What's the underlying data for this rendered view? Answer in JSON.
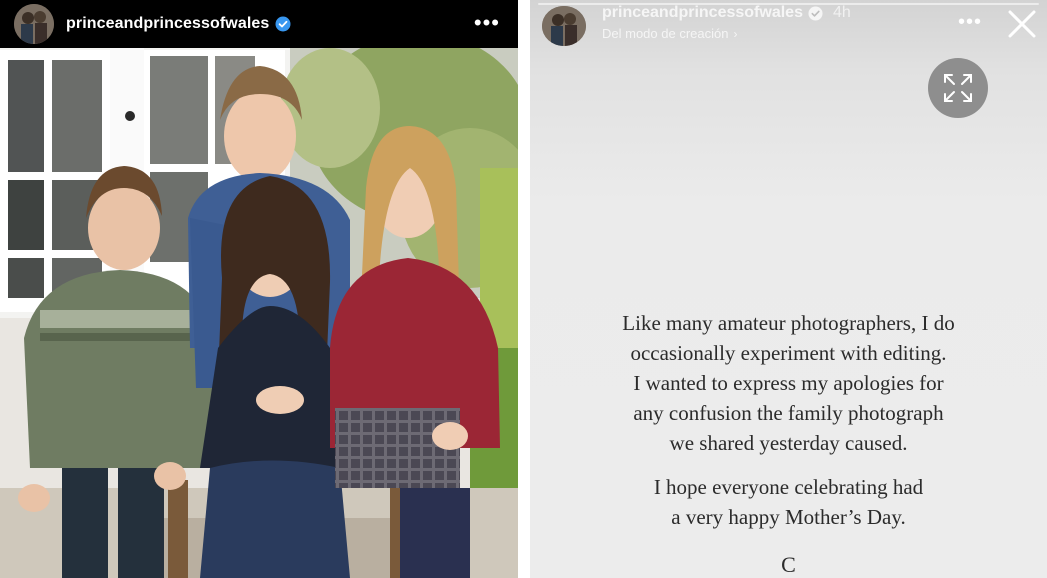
{
  "post": {
    "username": "princeandprincessofwales",
    "more_label": "•••",
    "verified_icon": "verified-badge-icon",
    "accent_color": "#3897f0"
  },
  "story": {
    "username": "princeandprincessofwales",
    "time": "4h",
    "subtitle": "Del modo de creación",
    "subtitle_chevron": "›",
    "more_label": "•••",
    "close_icon": "close-icon",
    "expand_icon": "expand-icon",
    "message_paragraph1": [
      "Like many amateur photographers, I do",
      "occasionally experiment with editing.",
      "I wanted to express my apologies for",
      "any confusion the family photograph",
      "we shared yesterday caused."
    ],
    "message_paragraph2": [
      "I hope everyone celebrating had",
      "a very happy Mother’s Day."
    ],
    "signature": "C"
  }
}
